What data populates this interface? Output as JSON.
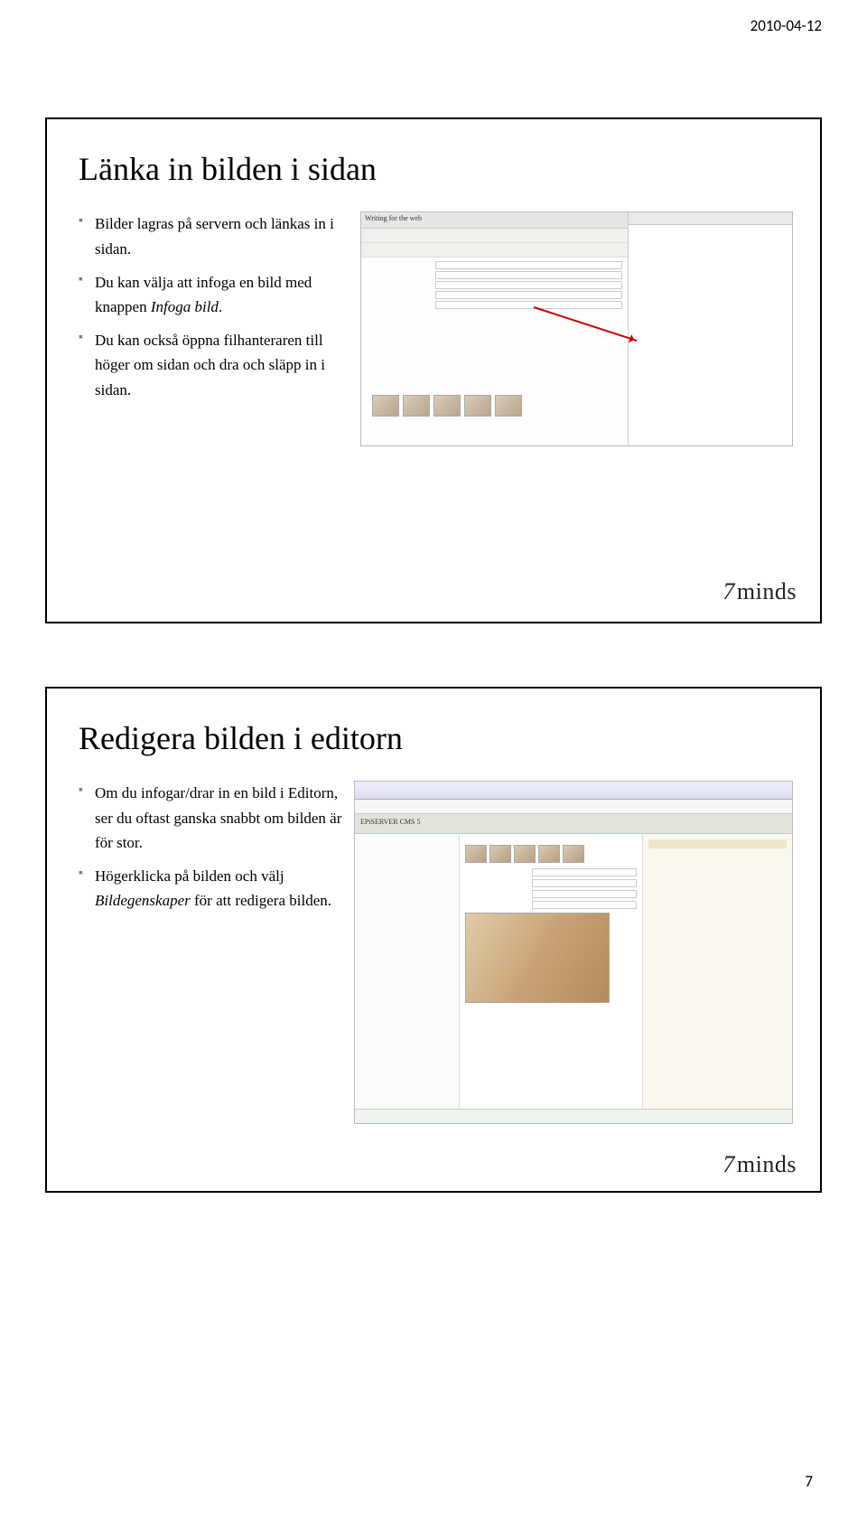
{
  "header_date": "2010-04-12",
  "page_number": "7",
  "logo_text": "minds",
  "logo_prefix": "7",
  "slide1": {
    "title": "Länka in bilden i sidan",
    "bullets": [
      {
        "html": "Bilder lagras på servern och länkas in i sidan."
      },
      {
        "html": "Du kan välja att infoga en bild med knappen <em>Infoga bild</em>."
      },
      {
        "html": "Du kan också öppna filhanteraren till höger om sidan och dra och släpp in i sidan."
      }
    ],
    "screenshot_caption": "Writing for the web"
  },
  "slide2": {
    "title": "Redigera bilden i editorn",
    "bullets": [
      {
        "html": "Om du infogar/drar in en bild i Editorn, ser du oftast ganska snabbt om bilden är för stor."
      },
      {
        "html": "Högerklicka på bilden och välj <em>Bildegenskaper</em> för att redigera bilden."
      }
    ],
    "cms_label": "EPiSERVER CMS 5"
  }
}
